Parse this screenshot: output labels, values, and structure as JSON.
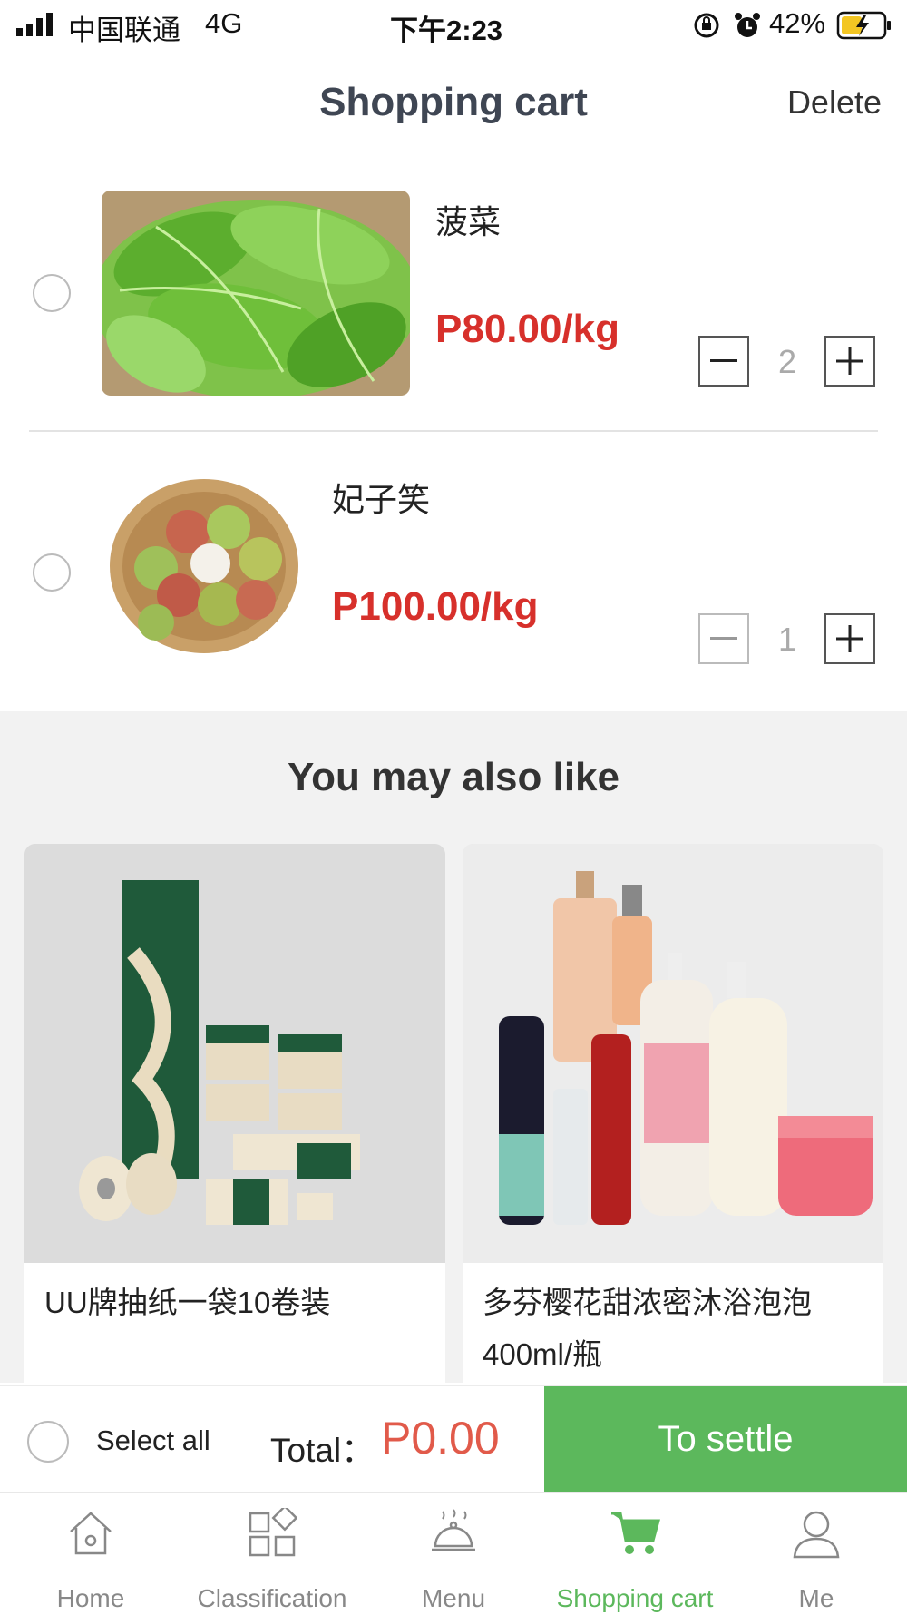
{
  "status_bar": {
    "carrier": "中国联通",
    "network": "4G",
    "time": "下午2:23",
    "battery_percent": "42%"
  },
  "header": {
    "title": "Shopping cart",
    "delete_label": "Delete"
  },
  "cart_items": [
    {
      "name": "菠菜",
      "price": "P80.00/kg",
      "quantity": "2",
      "selected": false,
      "decrement_enabled": true
    },
    {
      "name": "妃子笑",
      "price": "P100.00/kg",
      "quantity": "1",
      "selected": false,
      "decrement_enabled": false
    }
  ],
  "recommendations": {
    "title": "You may also like",
    "items": [
      {
        "label": "UU牌抽纸一袋10卷装"
      },
      {
        "label": "多芬樱花甜浓密沐浴泡泡400ml/瓶"
      }
    ]
  },
  "action_bar": {
    "select_all_label": "Select all",
    "total_label": "Total：",
    "total_value": "P0.00",
    "settle_label": "To settle"
  },
  "tabs": [
    {
      "label": "Home",
      "icon": "home-icon",
      "active": false
    },
    {
      "label": "Classification",
      "icon": "grid-icon",
      "active": false
    },
    {
      "label": "Menu",
      "icon": "cloche-icon",
      "active": false
    },
    {
      "label": "Shopping cart",
      "icon": "cart-icon",
      "active": true
    },
    {
      "label": "Me",
      "icon": "person-icon",
      "active": false
    }
  ],
  "colors": {
    "accent_green": "#5cb85c",
    "price_red": "#d7302b",
    "total_red": "#e15a4a"
  }
}
